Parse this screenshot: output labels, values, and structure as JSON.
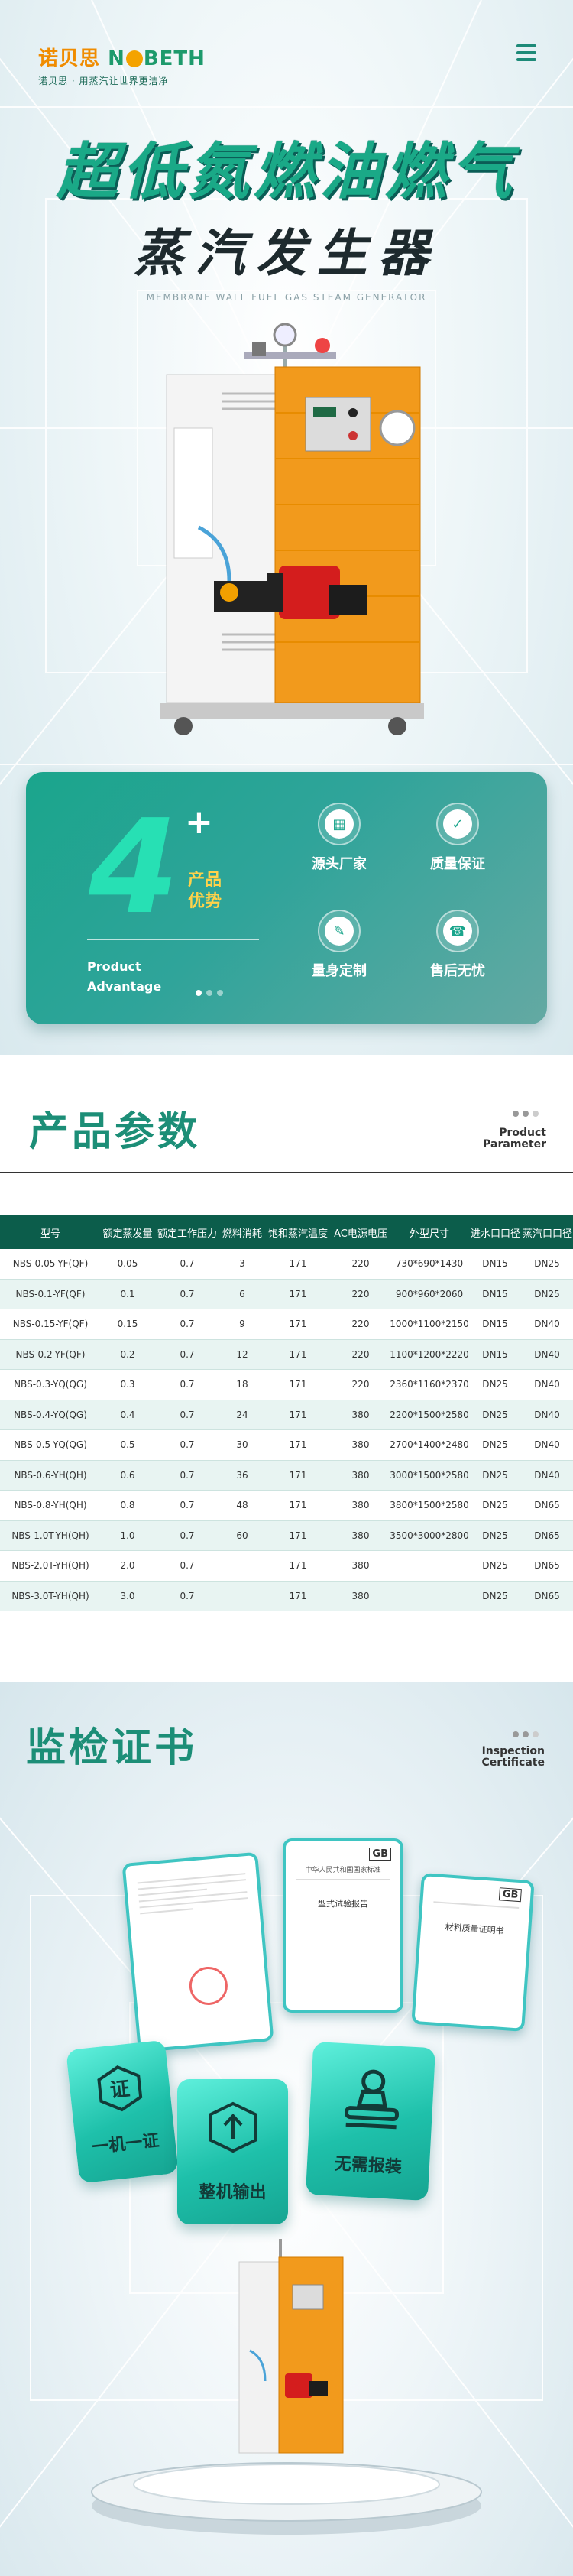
{
  "brand": {
    "logo_cn": "诺贝思",
    "logo_en_left": "N",
    "logo_en_right": "BETH",
    "slogan": "诺贝思 · 用蒸汽让世界更洁净"
  },
  "menu_icon": "hamburger-icon",
  "hero": {
    "title_line1": "超低氮燃油燃气",
    "title_line2": "蒸汽发生器",
    "subtitle_en": "MEMBRANE WALL FUEL GAS STEAM GENERATOR"
  },
  "advantages": {
    "number": "4",
    "plus": "+",
    "label_cn": "产品优势",
    "label_en_line1": "Product",
    "label_en_line2": "Advantage",
    "items": [
      {
        "label": "源头厂家",
        "icon": "factory-icon"
      },
      {
        "label": "质量保证",
        "icon": "quality-badge-icon"
      },
      {
        "label": "量身定制",
        "icon": "customize-icon"
      },
      {
        "label": "售后无忧",
        "icon": "service-icon"
      }
    ]
  },
  "params": {
    "title": "产品参数",
    "en_line1": "Product",
    "en_line2": "Parameter",
    "headers": [
      "型号",
      "额定蒸发量",
      "额定工作压力",
      "燃料消耗",
      "饱和蒸汽温度",
      "AC电源电压",
      "外型尺寸",
      "进水口口径",
      "蒸汽口口径"
    ],
    "rows": [
      [
        "NBS-0.05-YF(QF)",
        "0.05",
        "0.7",
        "3",
        "171",
        "220",
        "730*690*1430",
        "DN15",
        "DN25"
      ],
      [
        "NBS-0.1-YF(QF)",
        "0.1",
        "0.7",
        "6",
        "171",
        "220",
        "900*960*2060",
        "DN15",
        "DN25"
      ],
      [
        "NBS-0.15-YF(QF)",
        "0.15",
        "0.7",
        "9",
        "171",
        "220",
        "1000*1100*2150",
        "DN15",
        "DN40"
      ],
      [
        "NBS-0.2-YF(QF)",
        "0.2",
        "0.7",
        "12",
        "171",
        "220",
        "1100*1200*2220",
        "DN15",
        "DN40"
      ],
      [
        "NBS-0.3-YQ(QG)",
        "0.3",
        "0.7",
        "18",
        "171",
        "220",
        "2360*1160*2370",
        "DN25",
        "DN40"
      ],
      [
        "NBS-0.4-YQ(QG)",
        "0.4",
        "0.7",
        "24",
        "171",
        "380",
        "2200*1500*2580",
        "DN25",
        "DN40"
      ],
      [
        "NBS-0.5-YQ(QG)",
        "0.5",
        "0.7",
        "30",
        "171",
        "380",
        "2700*1400*2480",
        "DN25",
        "DN40"
      ],
      [
        "NBS-0.6-YH(QH)",
        "0.6",
        "0.7",
        "36",
        "171",
        "380",
        "3000*1500*2580",
        "DN25",
        "DN40"
      ],
      [
        "NBS-0.8-YH(QH)",
        "0.8",
        "0.7",
        "48",
        "171",
        "380",
        "3800*1500*2580",
        "DN25",
        "DN65"
      ],
      [
        "NBS-1.0T-YH(QH)",
        "1.0",
        "0.7",
        "60",
        "171",
        "380",
        "3500*3000*2800",
        "DN25",
        "DN65"
      ],
      [
        "NBS-2.0T-YH(QH)",
        "2.0",
        "0.7",
        "",
        "171",
        "380",
        "",
        "DN25",
        "DN65"
      ],
      [
        "NBS-3.0T-YH(QH)",
        "3.0",
        "0.7",
        "",
        "171",
        "380",
        "",
        "DN25",
        "DN65"
      ]
    ]
  },
  "certs": {
    "title": "监检证书",
    "en_line1": "Inspection",
    "en_line2": "Certificate",
    "doc2_header": "中华人民共和国国家标准",
    "doc2_title": "型式试验报告",
    "doc3_title": "材料质量证明书",
    "tiles": [
      {
        "label": "一机一证",
        "icon": "certificate-icon"
      },
      {
        "label": "整机输出",
        "icon": "package-box-icon"
      },
      {
        "label": "无需报装",
        "icon": "approval-stamp-icon"
      }
    ]
  }
}
